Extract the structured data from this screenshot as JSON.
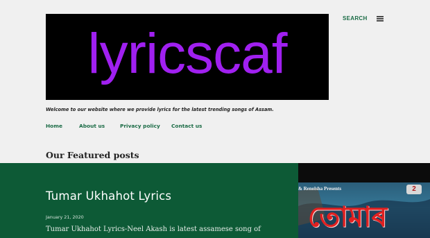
{
  "header": {
    "logo_text": "lyricscaf",
    "search_label": "SEARCH",
    "tagline": "Welcome to our website where we provide lyrics for the latest trending songs of Assam."
  },
  "nav": {
    "items": [
      "Home",
      "About us",
      "Privacy policy",
      "Contact us"
    ]
  },
  "featured": {
    "heading": "Our Featured posts",
    "post": {
      "title": "Tumar Ukhahot Lyrics",
      "date": "January 21, 2020",
      "excerpt": "Tumar Ukhahot Lyrics-Neel Akash is latest assamese song of",
      "thumb_caption": "& Renolsha Presents",
      "thumb_script": "তোমাৰ"
    }
  },
  "icons": [
    "menu-icon",
    "music-logo-icon"
  ],
  "colors": {
    "page_bg": "#f0f0f0",
    "accent_green": "#1a6b45",
    "panel_green": "#0d5a36",
    "logo_purple": "#a020f0",
    "logo_bg": "#000000",
    "text_dark": "#222222"
  }
}
